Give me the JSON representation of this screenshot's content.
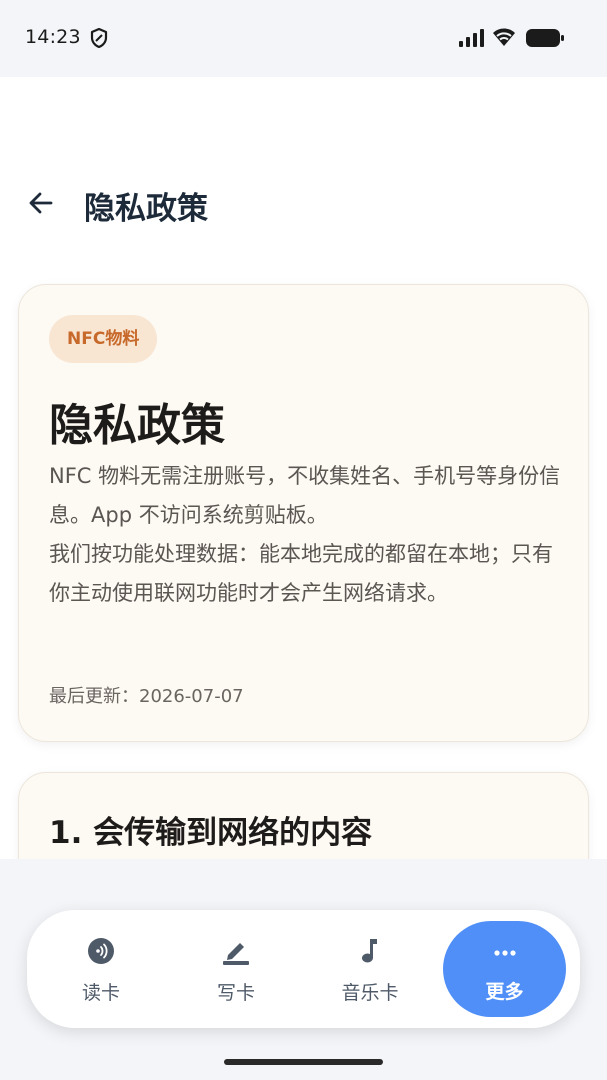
{
  "status_bar": {
    "time": "14:23",
    "icons": [
      "shield-icon",
      "signal-icon",
      "wifi-icon",
      "battery-icon"
    ]
  },
  "app_bar": {
    "back_icon": "back-arrow-icon",
    "title": "隐私政策"
  },
  "intro_card": {
    "tag": "NFC物料",
    "title": "隐私政策",
    "paragraphs": [
      "NFC 物料无需注册账号，不收集姓名、手机号等身份信息。App 不访问系统剪贴板。",
      "我们按功能处理数据：能本地完成的都留在本地；只有你主动使用联网功能时才会产生网络请求。"
    ],
    "updated": "最后更新：2026-07-07"
  },
  "section_card": {
    "title": "1. 会传输到网络的内容"
  },
  "bottom_nav": {
    "items": [
      {
        "label": "读卡",
        "icon": "nfc-read-icon",
        "active": false
      },
      {
        "label": "写卡",
        "icon": "pencil-icon",
        "active": false
      },
      {
        "label": "音乐卡",
        "icon": "music-note-icon",
        "active": false
      },
      {
        "label": "更多",
        "icon": "more-dots-icon",
        "active": true
      }
    ]
  },
  "colors": {
    "accent": "#4f8ff7",
    "tag_bg": "#f8e6d3",
    "tag_text": "#c7692a",
    "card_bg": "#fdf9f3"
  }
}
